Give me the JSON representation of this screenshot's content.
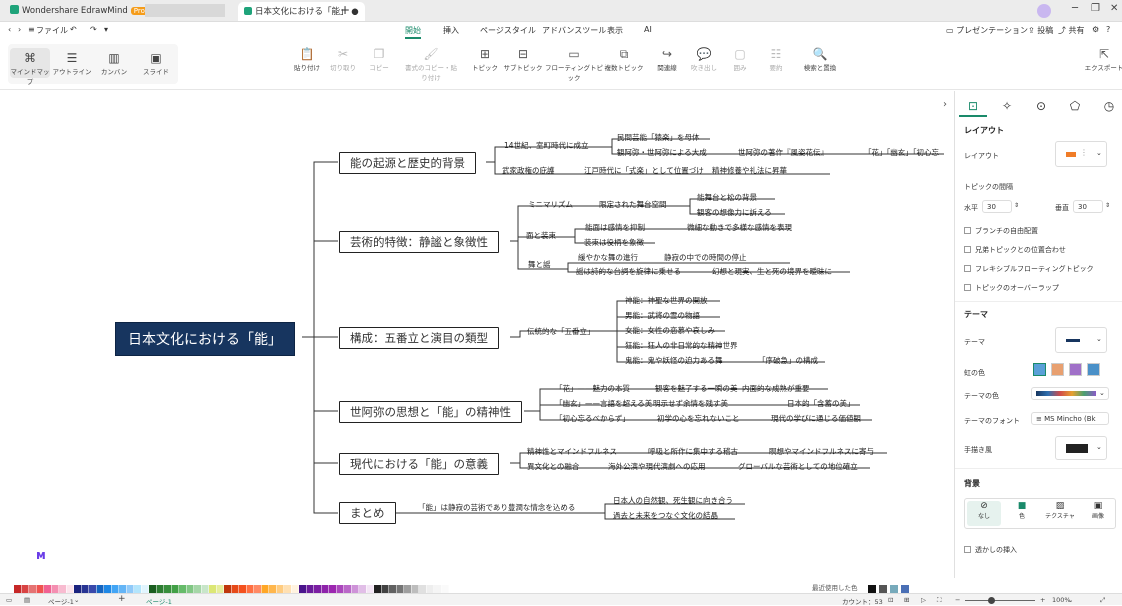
{
  "titlebar": {
    "app_tab": "Wondershare EdrawMind",
    "pro_badge": "Pro",
    "doc_tab": "日本文化における「能」",
    "new_tab": "+"
  },
  "menubar": {
    "file": "ファイル",
    "tabs": [
      "開始",
      "挿入",
      "ページスタイル",
      "アドバンスツール",
      "表示",
      "AI"
    ],
    "active_tab": "開始",
    "right": [
      "プレゼンテーション",
      "投稿",
      "共有"
    ]
  },
  "views": [
    "マインドマップ",
    "アウトライン",
    "カンバン",
    "スライド"
  ],
  "toolbar": [
    "貼り付け",
    "切り取り",
    "コピー",
    "書式のコピー・貼り付け",
    "トピック",
    "サブトピック",
    "フローティングトピック",
    "複数トピック",
    "関連線",
    "吹き出し",
    "囲み",
    "要約",
    "検索と置換"
  ],
  "export": "エクスポート",
  "mindmap": {
    "root": "日本文化における「能」",
    "branches": [
      {
        "label": "能の起源と歴史的背景",
        "subs": [
          "14世紀、室町時代に成立",
          "武家政権の庇護",
          "民間芸能「猿楽」を母体",
          "観阿弥・世阿弥による大成",
          "江戸時代に「式楽」として位置づけ",
          "世阿弥の著作『風姿花伝』",
          "「花」「幽玄」「初心忘",
          "精神修養や礼法に昇華"
        ]
      },
      {
        "label": "芸術的特徴：静謐と象徴性",
        "subs": [
          "ミニマリズム",
          "限定された舞台空間",
          "能舞台と松の背景",
          "観客の想像力に訴える",
          "面と装束",
          "能面は感情を抑制",
          "微細な動きで多様な感情を表現",
          "装束は役柄を象徴",
          "舞と謡",
          "緩やかな舞の進行",
          "静寂の中での時間の停止",
          "謡は詩的な台詞を旋律に乗せる",
          "幻想と現実、生と死の境界を曖昧に"
        ]
      },
      {
        "label": "構成：五番立と演目の類型",
        "subs": [
          "伝統的な「五番立」",
          "神能：神聖な世界の開放",
          "男能：武将の霊の物語",
          "女能：女性の恋慕や哀しみ",
          "狂能：狂人の非日常的な精神世界",
          "鬼能：鬼や妖怪の迫力ある舞",
          "「序破急」の構成"
        ]
      },
      {
        "label": "世阿弥の思想と「能」の精神性",
        "subs": [
          "「花」——魅力の本質",
          "観客を魅了する一瞬の美",
          "内面的な成熟が重要",
          "「幽玄」——言語を超える美",
          "明示せず余情を残す美",
          "日本的「含蓄の美」",
          "「初心忘るべからず」",
          "初学の心を忘れないこと",
          "現代の学びに通じる価値観"
        ]
      },
      {
        "label": "現代における「能」の意義",
        "subs": [
          "精神性とマインドフルネス",
          "呼吸と所作に集中する稽古",
          "瞑想やマインドフルネスに寄与",
          "異文化との融合",
          "海外公演や現代演劇への応用",
          "グローバルな芸術としての地位確立"
        ]
      },
      {
        "label": "まとめ",
        "subs": [
          "「能」は静寂の芸術であり豊潤な情念を込める",
          "日本人の自然観、死生観に向き合う",
          "過去と未来をつなぐ文化の結晶"
        ]
      }
    ]
  },
  "panel": {
    "layout_header": "レイアウト",
    "layout_label": "レイアウト",
    "spacing_label": "トピックの間隔",
    "horizontal_label": "水平",
    "horizontal_value": "30",
    "vertical_label": "垂直",
    "vertical_value": "30",
    "options": [
      "ブランチの自由配置",
      "兄弟トピックとの位置合わせ",
      "フレキシブルフローティングトピック",
      "トピックのオーバーラップ"
    ],
    "theme_header": "テーマ",
    "theme_label": "テーマ",
    "rainbow_label": "虹の色",
    "theme_color_label": "テーマの色",
    "theme_font_label": "テーマのフォント",
    "theme_font_value": "MS Mincho (Bk",
    "handdrawn_label": "手描き風",
    "bg_header": "背景",
    "bg_options": [
      "なし",
      "色",
      "テクスチャ",
      "画像"
    ],
    "watermark": "透かしの挿入"
  },
  "statusbar": {
    "page_select": "ページ-1",
    "add_page": "+",
    "page_tab": "ページ-1",
    "count": "カウント：53",
    "zoom": "100%",
    "recent_label": "最近使用した色"
  },
  "colors": {
    "accent": "#1a8a6a",
    "root_bg": "#17355f"
  }
}
